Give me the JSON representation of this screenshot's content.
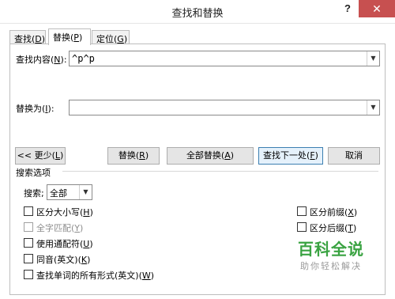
{
  "window": {
    "title": "查找和替换",
    "help": "?",
    "close": "✕"
  },
  "tabs": [
    {
      "label": "查找(",
      "key": "D",
      "tail": ")"
    },
    {
      "label": "替换(",
      "key": "P",
      "tail": ")"
    },
    {
      "label": "定位(",
      "key": "G",
      "tail": ")"
    }
  ],
  "find": {
    "label_a": "查找内容(",
    "key": "N",
    "label_b": "):",
    "value": "^p^p"
  },
  "replace": {
    "label_a": "替换为(",
    "key": "I",
    "label_b": "):",
    "value": ""
  },
  "buttons": {
    "less": {
      "a": "<< 更少(",
      "key": "L",
      "b": ")"
    },
    "replace": {
      "a": "替换(",
      "key": "R",
      "b": ")"
    },
    "replace_all": {
      "a": "全部替换(",
      "key": "A",
      "b": ")"
    },
    "find_next": {
      "a": "查找下一处(",
      "key": "F",
      "b": ")"
    },
    "cancel": "取消"
  },
  "search_options": {
    "header": "搜索选项",
    "search_label_a": "搜索",
    "search_key": "",
    "search_label_b": ";",
    "search_value": "全部",
    "options_left": [
      {
        "a": "区分大小写(",
        "key": "H",
        "b": ")"
      },
      {
        "a": "全字匹配(",
        "key": "Y",
        "b": ")"
      },
      {
        "a": "使用通配符(",
        "key": "U",
        "b": ")"
      },
      {
        "a": "同音(英文)(",
        "key": "K",
        "b": ")"
      },
      {
        "a": "查找单词的所有形式(英文)(",
        "key": "W",
        "b": ")"
      }
    ],
    "options_right": [
      {
        "a": "区分前缀(",
        "key": "X",
        "b": ")"
      },
      {
        "a": "区分后缀(",
        "key": "T",
        "b": ")"
      }
    ]
  },
  "watermark": {
    "main": "百科全说",
    "sub": "助你轻松解决"
  }
}
